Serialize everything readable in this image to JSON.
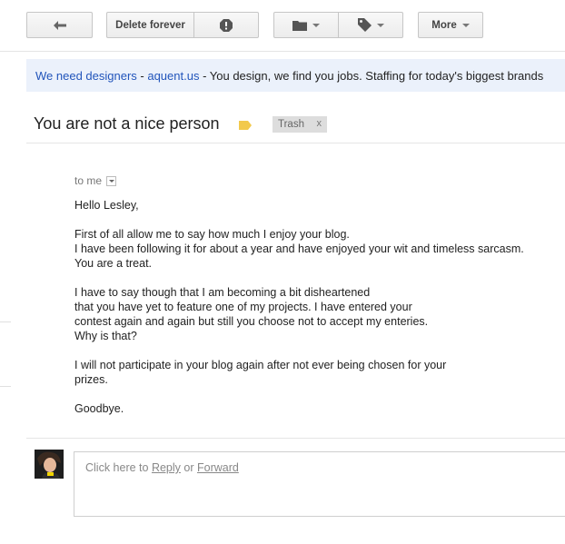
{
  "toolbar": {
    "back_icon": "arrow-left-icon",
    "delete_label": "Delete forever",
    "spam_icon": "report-spam-icon",
    "folder_icon": "folder-icon",
    "label_icon": "tag-icon",
    "more_label": "More"
  },
  "ad": {
    "link1": "We need designers",
    "sep": " - ",
    "link2": "aquent.us",
    "text": " - You design, we find you jobs. Staffing for today's biggest brands"
  },
  "subject": {
    "title": "You are not a nice person",
    "label_color": "#f2c94c",
    "chip_label": "Trash",
    "chip_close": "x"
  },
  "message": {
    "to": "to me",
    "greeting": "Hello Lesley,",
    "para1_l1": "First of all allow me to say how much I enjoy your blog.",
    "para1_l2": "I have been following it for about a year and have enjoyed your wit and timeless sarcasm.",
    "para1_l3": "You are a treat.",
    "para2_l1": "I have to say though that I am becoming a bit disheartened",
    "para2_l2": "that you have yet to feature one of my projects. I have entered your",
    "para2_l3": "contest again and again but still you choose not to accept my enteries.",
    "para2_l4": "Why is that?",
    "para3_l1": "I will not participate in your blog again after not ever being chosen for your",
    "para3_l2": "prizes.",
    "closing": "Goodbye."
  },
  "reply": {
    "prefix": "Click here to ",
    "reply_link": "Reply",
    "or": " or ",
    "forward_link": "Forward"
  }
}
